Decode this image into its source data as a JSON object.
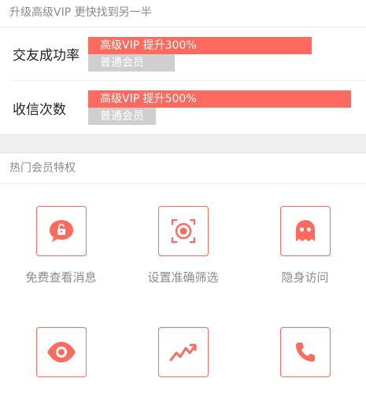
{
  "upgrade": {
    "header": "升级高级VIP 更快找到另一半",
    "rows": [
      {
        "label": "交友成功率",
        "vip_bar": "高级VIP  提升300%",
        "normal_bar": "普通会员",
        "vip_ratio": 0.87,
        "normal_ratio": 0.31
      },
      {
        "label": "收信次数",
        "vip_bar": "高级VIP  提升500%",
        "normal_bar": "普通会员",
        "vip_ratio": 1.0,
        "normal_ratio": 0.25
      }
    ],
    "colors": {
      "vip": "#ff6a5f",
      "normal": "#cfcfcf"
    }
  },
  "features": {
    "header": "热门会员特权",
    "items": [
      {
        "label": "免费查看消息",
        "icon": "lock-chat-icon"
      },
      {
        "label": "设置准确筛选",
        "icon": "target-icon"
      },
      {
        "label": "隐身访问",
        "icon": "ghost-icon"
      },
      {
        "label": "",
        "icon": "eye-icon"
      },
      {
        "label": "",
        "icon": "trending-up-icon"
      },
      {
        "label": "",
        "icon": "phone-icon"
      }
    ]
  }
}
